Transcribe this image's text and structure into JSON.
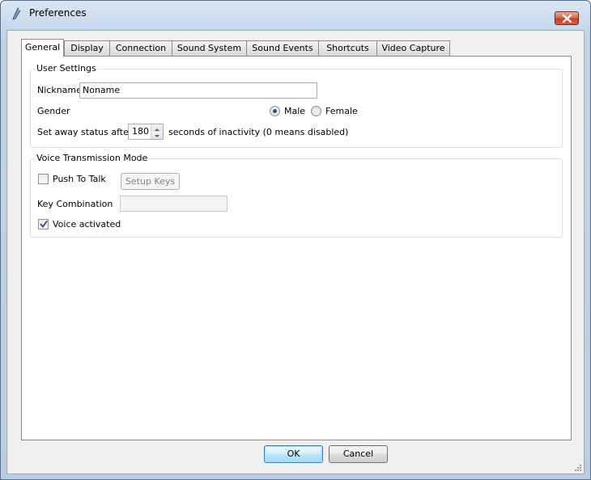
{
  "window": {
    "title": "Preferences"
  },
  "tabs": [
    {
      "label": "General",
      "active": true
    },
    {
      "label": "Display",
      "active": false
    },
    {
      "label": "Connection",
      "active": false
    },
    {
      "label": "Sound System",
      "active": false
    },
    {
      "label": "Sound Events",
      "active": false
    },
    {
      "label": "Shortcuts",
      "active": false
    },
    {
      "label": "Video Capture",
      "active": false
    }
  ],
  "user_settings": {
    "title": "User Settings",
    "nickname_label": "Nickname",
    "nickname_value": "Noname",
    "gender_label": "Gender",
    "gender_options": [
      {
        "label": "Male",
        "selected": true
      },
      {
        "label": "Female",
        "selected": false
      }
    ],
    "away_label": "Set away status after",
    "away_value": "180",
    "away_suffix": "seconds of inactivity (0 means disabled)"
  },
  "voice_mode": {
    "title": "Voice Transmission Mode",
    "push_to_talk_label": "Push To Talk",
    "push_to_talk_checked": false,
    "setup_keys_label": "Setup Keys",
    "key_combination_label": "Key Combination",
    "key_combination_value": "",
    "voice_activated_label": "Voice activated",
    "voice_activated_checked": true
  },
  "footer": {
    "ok_label": "OK",
    "cancel_label": "Cancel"
  },
  "colors": {
    "accent": "#3c7fb1",
    "close_button": "#c2432b",
    "title_bar": "#c9d9ec"
  }
}
